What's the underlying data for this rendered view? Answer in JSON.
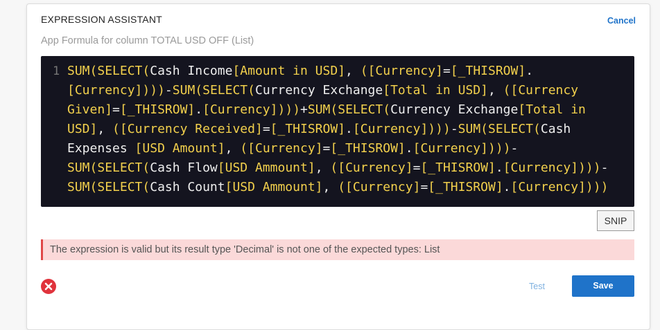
{
  "dialog": {
    "title": "EXPRESSION ASSISTANT",
    "cancel_label": "Cancel",
    "subtitle": "App Formula for column TOTAL USD OFF (List)"
  },
  "editor": {
    "line_number": "1",
    "lines": [
      [
        [
          "kw",
          "SUM"
        ],
        [
          "br",
          "("
        ],
        [
          "kw",
          "SELECT"
        ],
        [
          "br",
          "("
        ],
        [
          "tx",
          "Cash Income"
        ],
        [
          "br",
          "["
        ],
        [
          "kw",
          "Amount in USD"
        ],
        [
          "br",
          "]"
        ],
        [
          "tx",
          ", "
        ],
        [
          "br",
          "("
        ],
        [
          "br",
          "["
        ],
        [
          "kw",
          "Currency"
        ],
        [
          "br",
          "]"
        ],
        [
          "tx",
          "="
        ],
        [
          "br",
          "["
        ],
        [
          "kw",
          "_THISROW"
        ],
        [
          "br",
          "]"
        ],
        [
          "tx",
          "."
        ]
      ],
      [
        [
          "br",
          "["
        ],
        [
          "kw",
          "Currency"
        ],
        [
          "br",
          "]"
        ],
        [
          "br",
          ")"
        ],
        [
          "br",
          ")"
        ],
        [
          "br",
          ")"
        ],
        [
          "tx",
          "-"
        ],
        [
          "kw",
          "SUM"
        ],
        [
          "br",
          "("
        ],
        [
          "kw",
          "SELECT"
        ],
        [
          "br",
          "("
        ],
        [
          "tx",
          "Currency Exchange"
        ],
        [
          "br",
          "["
        ],
        [
          "kw",
          "Total in USD"
        ],
        [
          "br",
          "]"
        ],
        [
          "tx",
          ", "
        ],
        [
          "br",
          "("
        ],
        [
          "br",
          "["
        ],
        [
          "kw",
          "Currency"
        ]
      ],
      [
        [
          "kw",
          "Given"
        ],
        [
          "br",
          "]"
        ],
        [
          "tx",
          "="
        ],
        [
          "br",
          "["
        ],
        [
          "kw",
          "_THISROW"
        ],
        [
          "br",
          "]"
        ],
        [
          "tx",
          "."
        ],
        [
          "br",
          "["
        ],
        [
          "kw",
          "Currency"
        ],
        [
          "br",
          "]"
        ],
        [
          "br",
          ")"
        ],
        [
          "br",
          ")"
        ],
        [
          "br",
          ")"
        ],
        [
          "tx",
          "+"
        ],
        [
          "kw",
          "SUM"
        ],
        [
          "br",
          "("
        ],
        [
          "kw",
          "SELECT"
        ],
        [
          "br",
          "("
        ],
        [
          "tx",
          "Currency Exchange"
        ],
        [
          "br",
          "["
        ],
        [
          "kw",
          "Total in"
        ]
      ],
      [
        [
          "kw",
          "USD"
        ],
        [
          "br",
          "]"
        ],
        [
          "tx",
          ", "
        ],
        [
          "br",
          "("
        ],
        [
          "br",
          "["
        ],
        [
          "kw",
          "Currency Received"
        ],
        [
          "br",
          "]"
        ],
        [
          "tx",
          "="
        ],
        [
          "br",
          "["
        ],
        [
          "kw",
          "_THISROW"
        ],
        [
          "br",
          "]"
        ],
        [
          "tx",
          "."
        ],
        [
          "br",
          "["
        ],
        [
          "kw",
          "Currency"
        ],
        [
          "br",
          "]"
        ],
        [
          "br",
          ")"
        ],
        [
          "br",
          ")"
        ],
        [
          "br",
          ")"
        ],
        [
          "tx",
          "-"
        ],
        [
          "kw",
          "SUM"
        ],
        [
          "br",
          "("
        ],
        [
          "kw",
          "SELECT"
        ],
        [
          "br",
          "("
        ],
        [
          "tx",
          "Cash"
        ]
      ],
      [
        [
          "tx",
          "Expenses "
        ],
        [
          "br",
          "["
        ],
        [
          "kw",
          "USD Amount"
        ],
        [
          "br",
          "]"
        ],
        [
          "tx",
          ", "
        ],
        [
          "br",
          "("
        ],
        [
          "br",
          "["
        ],
        [
          "kw",
          "Currency"
        ],
        [
          "br",
          "]"
        ],
        [
          "tx",
          "="
        ],
        [
          "br",
          "["
        ],
        [
          "kw",
          "_THISROW"
        ],
        [
          "br",
          "]"
        ],
        [
          "tx",
          "."
        ],
        [
          "br",
          "["
        ],
        [
          "kw",
          "Currency"
        ],
        [
          "br",
          "]"
        ],
        [
          "br",
          ")"
        ],
        [
          "br",
          ")"
        ],
        [
          "br",
          ")"
        ],
        [
          "tx",
          "-"
        ]
      ],
      [
        [
          "kw",
          "SUM"
        ],
        [
          "br",
          "("
        ],
        [
          "kw",
          "SELECT"
        ],
        [
          "br",
          "("
        ],
        [
          "tx",
          "Cash Flow"
        ],
        [
          "br",
          "["
        ],
        [
          "kw",
          "USD Ammount"
        ],
        [
          "br",
          "]"
        ],
        [
          "tx",
          ", "
        ],
        [
          "br",
          "("
        ],
        [
          "br",
          "["
        ],
        [
          "kw",
          "Currency"
        ],
        [
          "br",
          "]"
        ],
        [
          "tx",
          "="
        ],
        [
          "br",
          "["
        ],
        [
          "kw",
          "_THISROW"
        ],
        [
          "br",
          "]"
        ],
        [
          "tx",
          "."
        ],
        [
          "br",
          "["
        ],
        [
          "kw",
          "Currency"
        ],
        [
          "br",
          "]"
        ],
        [
          "br",
          ")"
        ],
        [
          "br",
          ")"
        ],
        [
          "br",
          ")"
        ],
        [
          "tx",
          "-"
        ]
      ],
      [
        [
          "kw",
          "SUM"
        ],
        [
          "br",
          "("
        ],
        [
          "kw",
          "SELECT"
        ],
        [
          "br",
          "("
        ],
        [
          "tx",
          "Cash Count"
        ],
        [
          "br",
          "["
        ],
        [
          "kw",
          "USD Ammount"
        ],
        [
          "br",
          "]"
        ],
        [
          "tx",
          ", "
        ],
        [
          "br",
          "("
        ],
        [
          "br",
          "["
        ],
        [
          "kw",
          "Currency"
        ],
        [
          "br",
          "]"
        ],
        [
          "tx",
          "="
        ],
        [
          "br",
          "["
        ],
        [
          "kw",
          "_THISROW"
        ],
        [
          "br",
          "]"
        ],
        [
          "tx",
          "."
        ],
        [
          "br",
          "["
        ],
        [
          "kw",
          "Currency"
        ],
        [
          "br",
          "]"
        ],
        [
          "br",
          ")"
        ],
        [
          "br",
          ")"
        ],
        [
          "br",
          ")"
        ]
      ]
    ]
  },
  "snip_label": "SNIP",
  "error_message": "The expression is valid but its result type 'Decimal' is not one of the expected types: List",
  "footer": {
    "test_label": "Test",
    "save_label": "Save"
  },
  "colors": {
    "accent": "#1f73c9",
    "editor_bg": "#14141f",
    "keyword": "#f2d04c",
    "error_bg": "#fbd9d9",
    "error_icon": "#e0333c"
  },
  "icons": {
    "error": "close-circle-icon"
  }
}
